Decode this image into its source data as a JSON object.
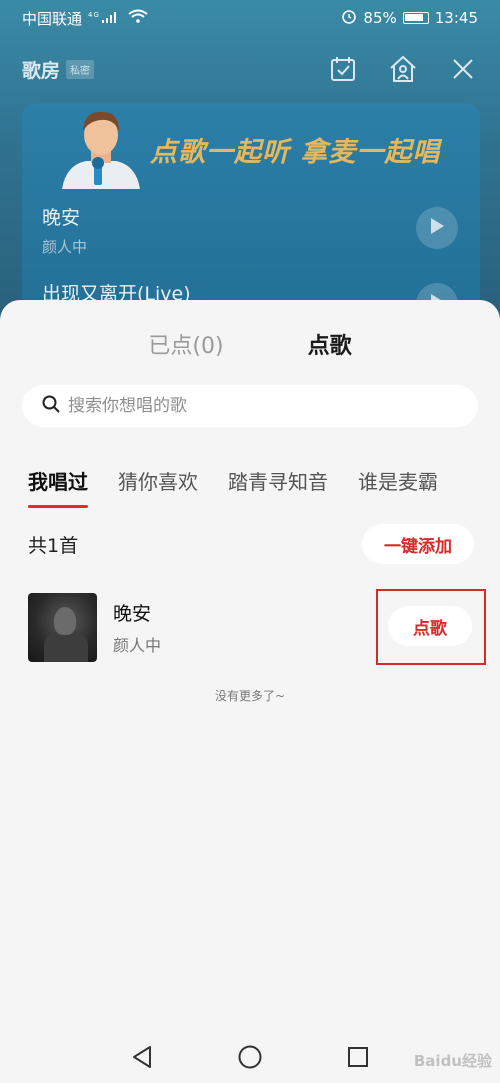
{
  "status": {
    "carrier": "中国联通",
    "network": "4G",
    "battery": "85%",
    "time": "13:45"
  },
  "room": {
    "title": "歌房",
    "tag": "私密",
    "slogan": "点歌一起听  拿麦一起唱",
    "songs": [
      {
        "name": "晚安",
        "artist": "颜人中"
      },
      {
        "name": "出现又离开(Live)",
        "artist": ""
      }
    ]
  },
  "sheet": {
    "tabs": [
      {
        "label": "已点(0)",
        "active": false
      },
      {
        "label": "点歌",
        "active": true
      }
    ],
    "search_placeholder": "搜索你想唱的歌",
    "categories": [
      {
        "label": "我唱过",
        "active": true
      },
      {
        "label": "猜你喜欢",
        "active": false
      },
      {
        "label": "踏青寻知音",
        "active": false
      },
      {
        "label": "谁是麦霸",
        "active": false
      }
    ],
    "count_text": "共1首",
    "add_all_label": "一键添加",
    "list": [
      {
        "name": "晚安",
        "artist": "颜人中",
        "action": "点歌"
      }
    ],
    "no_more": "没有更多了~"
  },
  "watermark": "Baidu经验",
  "colors": {
    "accent_red": "#d82a2a",
    "room_bg": "#2f7290",
    "slogan": "#e5b85c"
  }
}
